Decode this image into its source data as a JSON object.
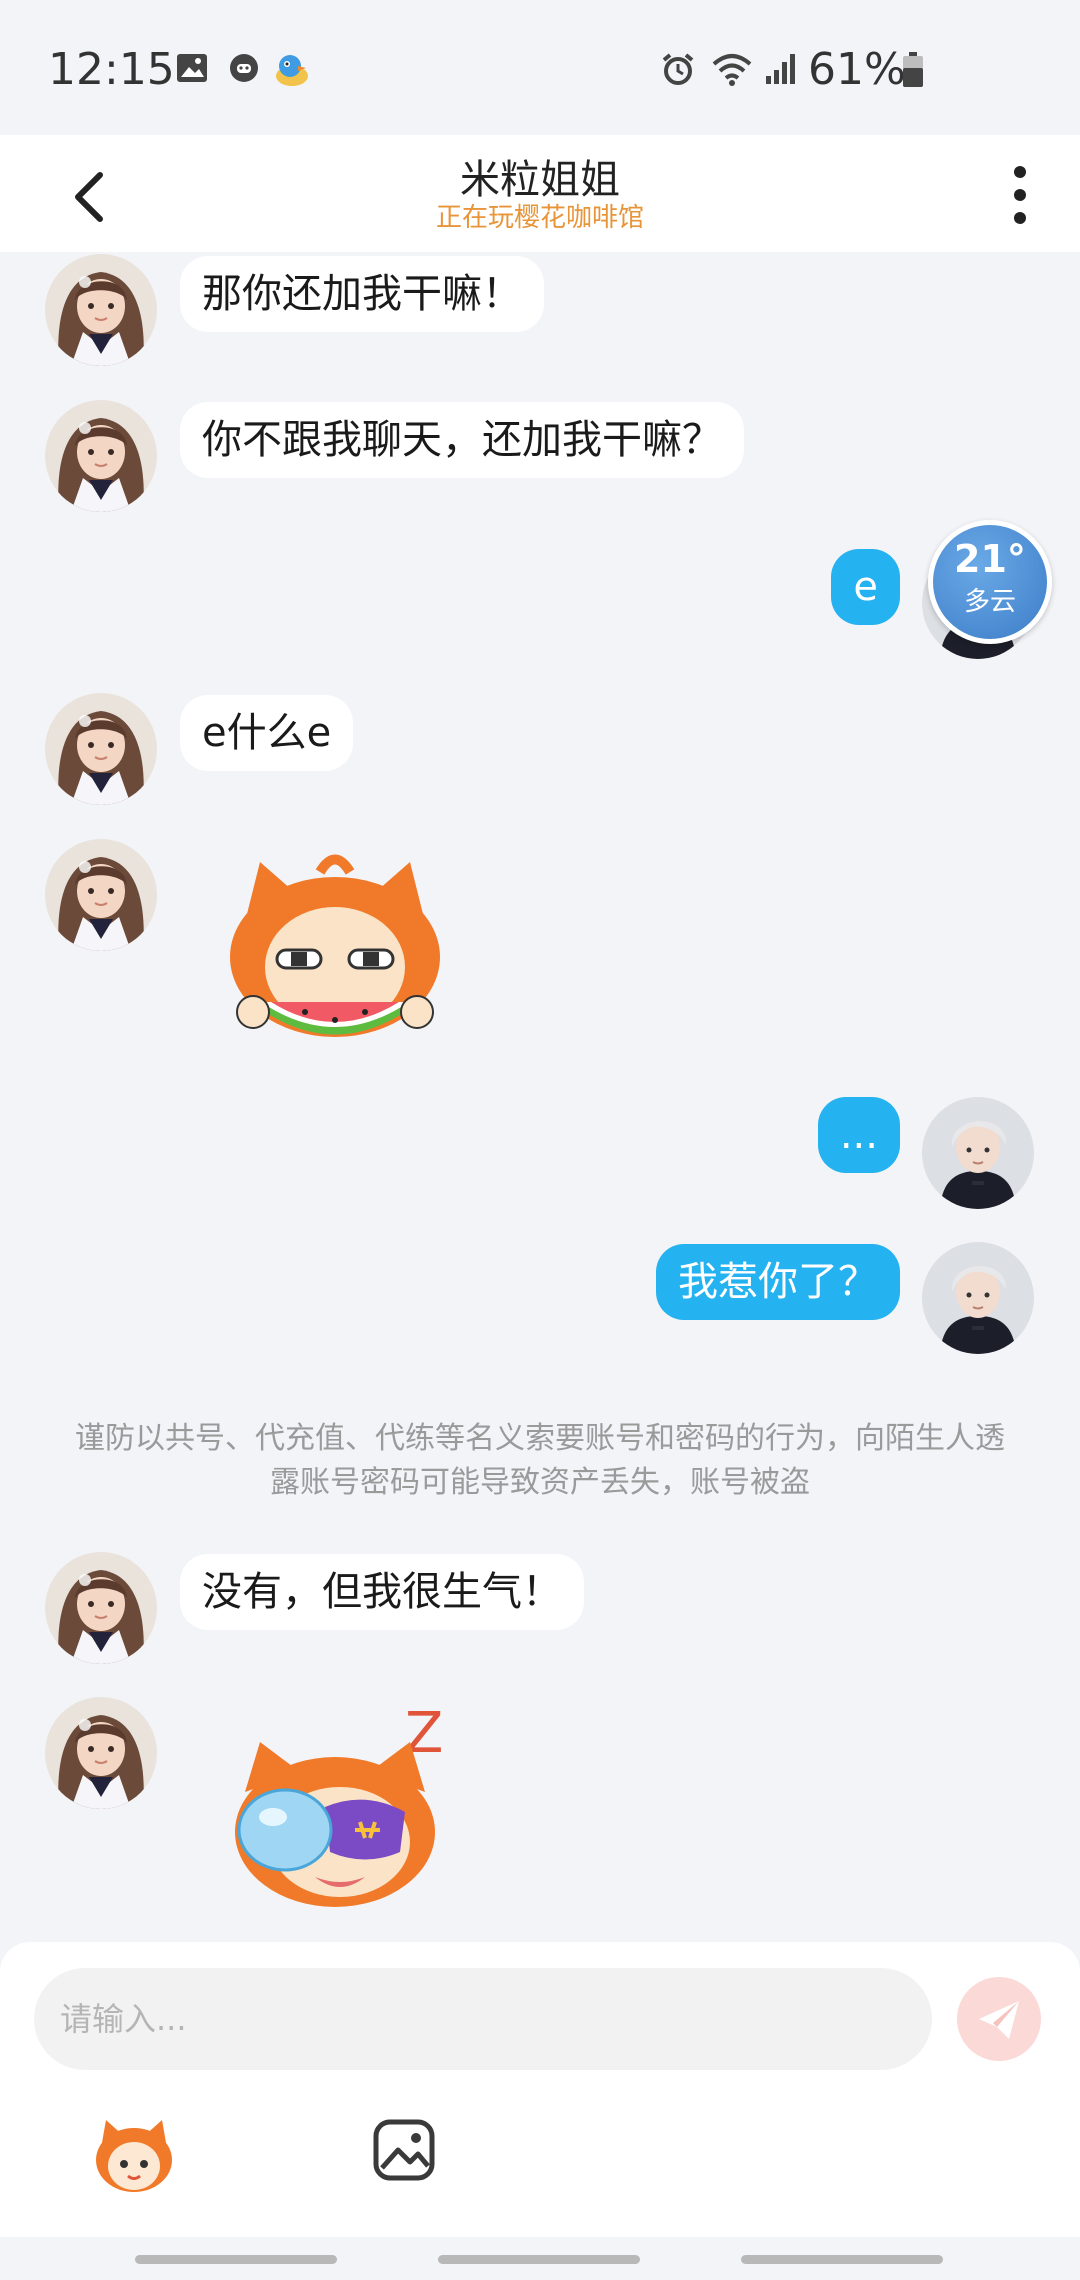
{
  "status_bar": {
    "time": "12:15",
    "battery_percent": "61%",
    "icons": [
      "image-icon",
      "game-icon",
      "weather-bird-icon",
      "alarm-icon",
      "wifi-icon",
      "signal-icon",
      "battery-icon"
    ]
  },
  "header": {
    "title": "米粒姐姐",
    "subtitle": "正在玩樱花咖啡馆",
    "back_icon": "chevron-left-icon",
    "more_icon": "more-vertical-icon"
  },
  "messages": [
    {
      "side": "left",
      "type": "text",
      "text": "那你还加我干嘛！"
    },
    {
      "side": "left",
      "type": "text",
      "text": "你不跟我聊天，还加我干嘛？"
    },
    {
      "side": "right",
      "type": "text",
      "text": "e"
    },
    {
      "side": "left",
      "type": "text",
      "text": "e什么e"
    },
    {
      "side": "left",
      "type": "sticker",
      "sticker": "watermelon-eating-sticker"
    },
    {
      "side": "right",
      "type": "text",
      "text": "..."
    },
    {
      "side": "right",
      "type": "text",
      "text": "我惹你了？"
    },
    {
      "side": "left",
      "type": "text",
      "text": "没有，但我很生气！"
    },
    {
      "side": "left",
      "type": "sticker",
      "sticker": "sleeping-sticker"
    }
  ],
  "system_notice": "谨防以共号、代充值、代练等名义索要账号和密码的行为，向陌生人透露账号密码可能导致资产丢失，账号被盗",
  "weather": {
    "temp": "21°",
    "desc": "多云"
  },
  "input": {
    "placeholder": "请输入..."
  },
  "toolbar": {
    "emoji_icon": "mascot-emoji-icon",
    "image_icon": "image-icon",
    "send_icon": "send-icon"
  },
  "colors": {
    "accent_blue": "#24b2f0",
    "subtitle_orange": "#e8953a",
    "send_button_bg": "#fbd9d6",
    "background": "#f3f4f8"
  }
}
